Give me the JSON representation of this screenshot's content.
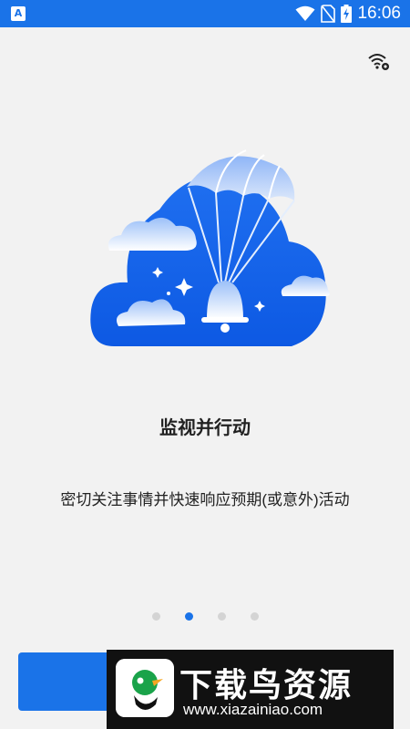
{
  "status_bar": {
    "time": "16:06",
    "app_icon_letter": "A",
    "icons": [
      "wifi-icon",
      "no-sim-icon",
      "battery-charging-icon"
    ]
  },
  "settings_icon": "wifi-settings-icon",
  "onboarding": {
    "title": "监视并行动",
    "description": "密切关注事情并快速响应预期(或意外)活动",
    "page_count": 4,
    "current_page": 2
  },
  "primary_button": {
    "label": ""
  },
  "watermark": {
    "title": "下载鸟资源",
    "url": "www.xiazainiao.com"
  },
  "colors": {
    "accent": "#1a73e8",
    "background": "#f2f2f2",
    "text": "#222222"
  }
}
